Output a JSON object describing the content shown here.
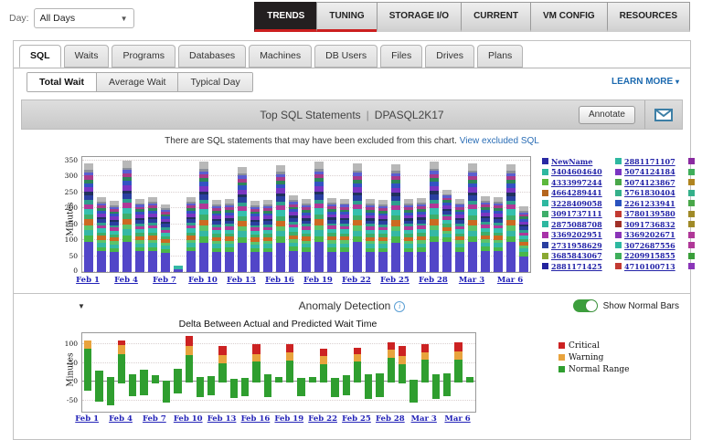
{
  "topbar": {
    "day_label": "Day:",
    "day_value": "All Days",
    "nav_tabs": [
      {
        "label": "TRENDS",
        "active": true,
        "redline": true
      },
      {
        "label": "TUNING",
        "active": false,
        "redline": true
      },
      {
        "label": "STORAGE I/O",
        "active": false,
        "redline": false
      },
      {
        "label": "CURRENT",
        "active": false,
        "redline": false
      },
      {
        "label": "VM CONFIG",
        "active": false,
        "redline": false
      },
      {
        "label": "RESOURCES",
        "active": false,
        "redline": false
      }
    ]
  },
  "tabs": {
    "items": [
      "SQL",
      "Waits",
      "Programs",
      "Databases",
      "Machines",
      "DB Users",
      "Files",
      "Drives",
      "Plans"
    ],
    "active_index": 0
  },
  "subtabs": {
    "items": [
      "Total Wait",
      "Average Wait",
      "Typical Day"
    ],
    "active_index": 0,
    "learn_more": "LEARN MORE",
    "learn_more_caret": "▾"
  },
  "panel_header": {
    "title": "Top SQL Statements",
    "pipe": "|",
    "server": "DPASQL2K17",
    "annotate_label": "Annotate"
  },
  "notice": {
    "text": "There are SQL statements that may have been excluded from this chart.",
    "link": "View excluded SQL"
  },
  "anomaly_header": {
    "collapse_icon": "▼",
    "title": "Anomaly Detection",
    "info_icon": "i",
    "toggle_label": "Show Normal Bars",
    "toggle_on": true,
    "toggle_color": "#3d9e3d"
  },
  "chart_data": [
    {
      "type": "stacked-bar",
      "title": "Top SQL Statements",
      "ylabel": "Minutes",
      "ylim": [
        0,
        360
      ],
      "yticks": [
        0,
        50,
        100,
        150,
        200,
        250,
        300,
        350
      ],
      "x_tick_labels": [
        "Feb 1",
        "Feb 4",
        "Feb 7",
        "Feb 10",
        "Feb 13",
        "Feb 16",
        "Feb 19",
        "Feb 22",
        "Feb 25",
        "Feb 28",
        "Mar 3",
        "Mar 6"
      ],
      "bar_base_color": "#5246c8",
      "tiny_top_color": "#35b8a5",
      "stack_pattern": [
        [
          "#49b749",
          0.075
        ],
        [
          "#35b8a5",
          0.075
        ],
        [
          "#5cc46a",
          0.06
        ],
        [
          "#cc6a22",
          0.075
        ],
        [
          "#3fae6a",
          0.06
        ],
        [
          "#35c0ae",
          0.075
        ],
        [
          "#b03898",
          0.06
        ],
        [
          "#2f9e8e",
          0.05
        ],
        [
          "#2a3fa0",
          0.065
        ],
        [
          "#20315e",
          0.04
        ],
        [
          "#7a35c2",
          0.065
        ],
        [
          "#3353c4",
          0.05
        ],
        [
          "#2d8659",
          0.045
        ],
        [
          "#a83a8a",
          0.05
        ],
        [
          "#5a5fd0",
          0.04
        ],
        [
          "#8a8f99",
          0.03
        ],
        [
          "#b8b8b8",
          0.085
        ]
      ],
      "bars_total_and_blue_base": [
        [
          340,
          95
        ],
        [
          235,
          65
        ],
        [
          222,
          63
        ],
        [
          348,
          95
        ],
        [
          230,
          65
        ],
        [
          235,
          65
        ],
        [
          212,
          60
        ],
        [
          20,
          8
        ],
        [
          235,
          65
        ],
        [
          345,
          92
        ],
        [
          225,
          63
        ],
        [
          228,
          64
        ],
        [
          330,
          92
        ],
        [
          222,
          62
        ],
        [
          225,
          63
        ],
        [
          335,
          92
        ],
        [
          240,
          66
        ],
        [
          228,
          64
        ],
        [
          345,
          93
        ],
        [
          232,
          64
        ],
        [
          230,
          64
        ],
        [
          340,
          93
        ],
        [
          228,
          63
        ],
        [
          225,
          63
        ],
        [
          338,
          92
        ],
        [
          228,
          63
        ],
        [
          232,
          64
        ],
        [
          345,
          94
        ],
        [
          258,
          95
        ],
        [
          230,
          64
        ],
        [
          340,
          93
        ],
        [
          238,
          66
        ],
        [
          235,
          65
        ],
        [
          338,
          93
        ],
        [
          205,
          50
        ]
      ],
      "legend": {
        "col1": [
          {
            "label": "NewName",
            "color": "#2929a3"
          },
          {
            "label": "5404604640",
            "color": "#2eb8a0"
          },
          {
            "label": "4333997244",
            "color": "#5cb83c"
          },
          {
            "label": "4664289441",
            "color": "#b5651d"
          },
          {
            "label": "3228409058",
            "color": "#2eb8a0"
          },
          {
            "label": "3091737111",
            "color": "#3fae6a"
          },
          {
            "label": "2875088708",
            "color": "#2eb8a0"
          },
          {
            "label": "3369202951",
            "color": "#a832a8"
          },
          {
            "label": "2731958629",
            "color": "#2a3fa0"
          },
          {
            "label": "3685843067",
            "color": "#8aa832"
          },
          {
            "label": "2881171425",
            "color": "#23239e"
          }
        ],
        "col2": [
          {
            "label": "2881171107",
            "color": "#2eb8a0"
          },
          {
            "label": "5074124184",
            "color": "#7a35c2"
          },
          {
            "label": "5074123867",
            "color": "#49a749"
          },
          {
            "label": "5761830404",
            "color": "#35b08a"
          },
          {
            "label": "2261233941",
            "color": "#2a52be"
          },
          {
            "label": "3780139580",
            "color": "#c23a32"
          },
          {
            "label": "3091736832",
            "color": "#a03028"
          },
          {
            "label": "3369202671",
            "color": "#8a35b8"
          },
          {
            "label": "3072687556",
            "color": "#2eb8a0"
          },
          {
            "label": "2209915855",
            "color": "#3fae5a"
          },
          {
            "label": "4710100713",
            "color": "#c23a32"
          }
        ],
        "col3_swatches": [
          "#8a2aa0",
          "#3fae5a",
          "#b08420",
          "#35b08a",
          "#49a749",
          "#a08a28",
          "#a08a28",
          "#b03898",
          "#b03898",
          "#3a9e3a",
          "#8a35b8"
        ]
      }
    },
    {
      "type": "diverging-stacked-bar",
      "title": "Delta Between Actual and Predicted Wait Time",
      "ylabel": "Minutes",
      "ylim": [
        -80,
        130
      ],
      "yticks": [
        -50,
        0,
        50,
        100
      ],
      "x_tick_labels": [
        "Feb 1",
        "Feb 4",
        "Feb 7",
        "Feb 10",
        "Feb 13",
        "Feb 16",
        "Feb 19",
        "Feb 22",
        "Feb 25",
        "Feb 28",
        "Mar 3",
        "Mar 6"
      ],
      "series_colors": {
        "critical": "#cc2222",
        "warning": "#e8a33d",
        "normal": "#2f9e2f"
      },
      "legend": [
        {
          "label": "Critical",
          "color": "#cc2222"
        },
        {
          "label": "Warning",
          "color": "#e8a33d"
        },
        {
          "label": "Normal Range",
          "color": "#2f9e2f"
        }
      ],
      "bars_normal_warning_critical_negative": [
        [
          88,
          22,
          0,
          -25
        ],
        [
          30,
          0,
          0,
          -52
        ],
        [
          12,
          0,
          0,
          -63
        ],
        [
          75,
          23,
          12,
          -5
        ],
        [
          20,
          0,
          0,
          -38
        ],
        [
          33,
          0,
          0,
          -35
        ],
        [
          18,
          0,
          0,
          -4
        ],
        [
          2,
          0,
          0,
          -55
        ],
        [
          35,
          0,
          0,
          -30
        ],
        [
          72,
          23,
          27,
          -3
        ],
        [
          13,
          0,
          0,
          -40
        ],
        [
          15,
          0,
          0,
          -35
        ],
        [
          50,
          22,
          25,
          -3
        ],
        [
          8,
          0,
          0,
          -43
        ],
        [
          10,
          0,
          0,
          -38
        ],
        [
          55,
          20,
          25,
          -3
        ],
        [
          20,
          0,
          0,
          -40
        ],
        [
          13,
          0,
          0,
          -3
        ],
        [
          58,
          22,
          21,
          -3
        ],
        [
          10,
          0,
          0,
          -38
        ],
        [
          13,
          0,
          0,
          -3
        ],
        [
          48,
          20,
          20,
          -3
        ],
        [
          11,
          0,
          0,
          -40
        ],
        [
          17,
          0,
          0,
          -35
        ],
        [
          55,
          20,
          17,
          -3
        ],
        [
          20,
          0,
          0,
          -45
        ],
        [
          22,
          0,
          0,
          -40
        ],
        [
          65,
          20,
          20,
          -3
        ],
        [
          48,
          22,
          25,
          -5
        ],
        [
          5,
          0,
          0,
          -55
        ],
        [
          60,
          20,
          20,
          -3
        ],
        [
          20,
          0,
          0,
          -45
        ],
        [
          22,
          0,
          0,
          -38
        ],
        [
          60,
          22,
          23,
          -3
        ],
        [
          12,
          0,
          0,
          -2
        ]
      ]
    }
  ]
}
